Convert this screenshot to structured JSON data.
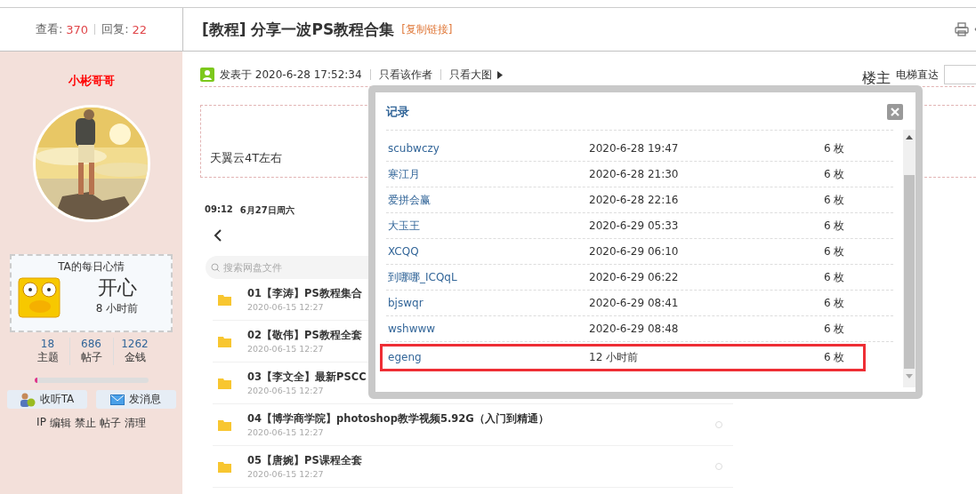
{
  "header": {
    "views_label": "查看:",
    "views": "370",
    "replies_label": "回复:",
    "replies": "22",
    "title": "[教程] 分享一波PS教程合集",
    "copy_link": "[复制链接]"
  },
  "author": {
    "name": "小彬哥哥",
    "mood": {
      "title": "TA的每日心情",
      "mood": "开心",
      "time": "8 小时前"
    },
    "stats": [
      {
        "value": "18",
        "label": "主题"
      },
      {
        "value": "686",
        "label": "帖子"
      },
      {
        "value": "1262",
        "label": "金钱"
      }
    ],
    "level": 0.03,
    "buttons": [
      {
        "label": "收听TA",
        "kind": "follow"
      },
      {
        "label": "发消息",
        "kind": "message"
      }
    ],
    "admin_links": [
      "IP",
      "编辑",
      "禁止",
      "帖子",
      "清理"
    ]
  },
  "post": {
    "posted": "发表于 2020-6-28 17:52:34",
    "only_author": "只看该作者",
    "big_images": "只看大图",
    "floor": "楼主",
    "jump_label": "电梯直达",
    "body_text": "天翼云4T左右",
    "screenshot": {
      "status_time": "09:12",
      "status_date": "6月27日周六",
      "search_placeholder": "搜索网盘文件",
      "files": [
        {
          "name": "01【李涛】PS教程集合",
          "date": "2020-06-15 12:27"
        },
        {
          "name": "02【敬伟】PS教程全套",
          "date": "2020-06-15 12:27"
        },
        {
          "name": "03【李文全】最新PSCC",
          "date": "2020-06-15 12:27"
        },
        {
          "name": "04【博学商学院】photoshop教学视频5.92G（入门到精通）",
          "date": "2020-06-15 12:27",
          "select_circle": true
        },
        {
          "name": "05【唐婉】PS课程全套",
          "date": "2020-06-15 12:27",
          "select_circle": true
        }
      ]
    }
  },
  "dialog": {
    "title": "记录",
    "rows": [
      {
        "user": "scubwczy",
        "time": "2020-6-28 19:47",
        "amount": "6 枚",
        "highlighted": false
      },
      {
        "user": "寒江月",
        "time": "2020-6-28 21:30",
        "amount": "6 枚",
        "highlighted": false
      },
      {
        "user": "爱拼会赢",
        "time": "2020-6-28 22:16",
        "amount": "6 枚",
        "highlighted": false
      },
      {
        "user": "大玉王",
        "time": "2020-6-29 05:33",
        "amount": "6 枚",
        "highlighted": false
      },
      {
        "user": "XCQQ",
        "time": "2020-6-29 06:10",
        "amount": "6 枚",
        "highlighted": false
      },
      {
        "user": "到哪哪_ICQqL",
        "time": "2020-6-29 06:22",
        "amount": "6 枚",
        "highlighted": false
      },
      {
        "user": "bjswqr",
        "time": "2020-6-29 08:41",
        "amount": "6 枚",
        "highlighted": false
      },
      {
        "user": "wshwww",
        "time": "2020-6-29 08:48",
        "amount": "6 枚",
        "highlighted": false
      },
      {
        "user": "egeng",
        "time": "12 小时前",
        "amount": "6 枚",
        "highlighted": true
      }
    ]
  }
}
